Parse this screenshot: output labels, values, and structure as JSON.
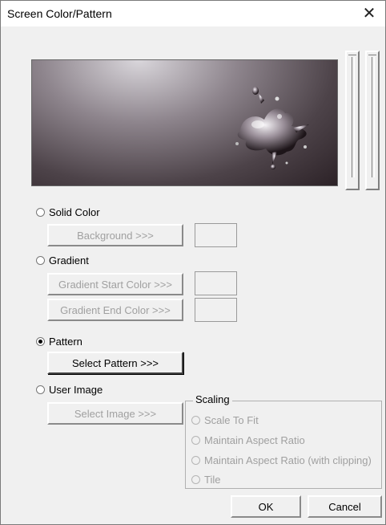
{
  "title": "Screen Color/Pattern",
  "close_icon": "close-icon",
  "options": {
    "solid_color": "Solid Color",
    "background_btn": "Background >>>",
    "gradient": "Gradient",
    "gradient_start_btn": "Gradient Start Color >>>",
    "gradient_end_btn": "Gradient End Color >>>",
    "pattern": "Pattern",
    "select_pattern_btn": "Select Pattern >>>",
    "user_image": "User Image",
    "select_image_btn": "Select Image >>>"
  },
  "scaling": {
    "title": "Scaling",
    "scale_to_fit": "Scale To Fit",
    "maintain_aspect": "Maintain Aspect Ratio",
    "maintain_aspect_clip": "Maintain Aspect Ratio (with clipping)",
    "tile": "Tile"
  },
  "buttons": {
    "ok": "OK",
    "cancel": "Cancel"
  },
  "selected_option": "pattern"
}
